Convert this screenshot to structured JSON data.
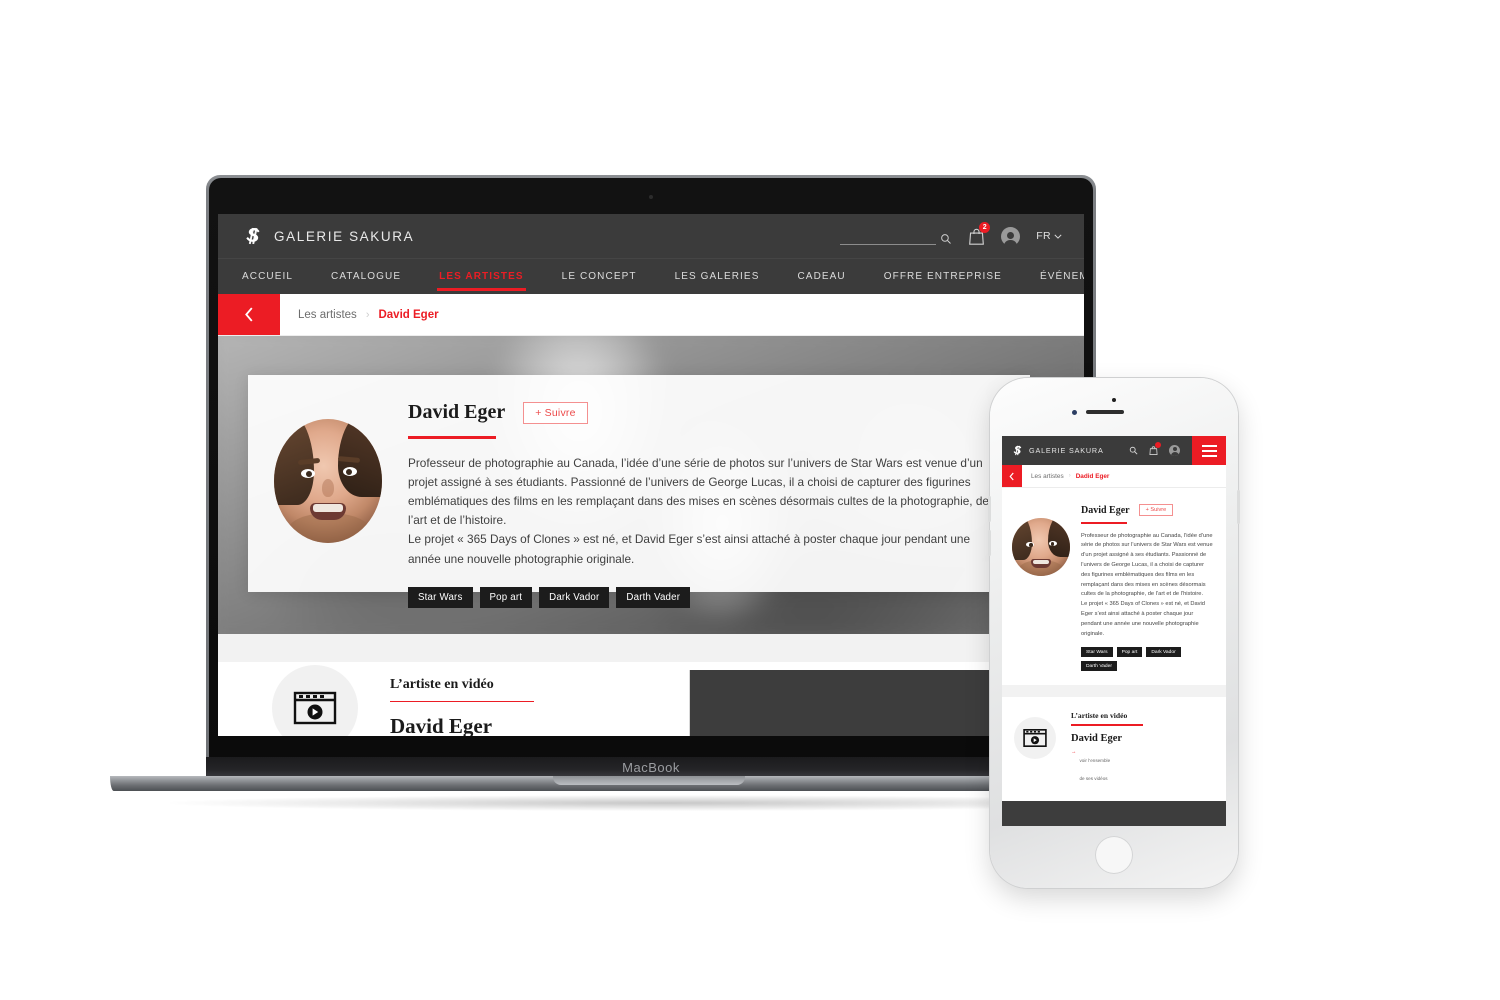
{
  "site": {
    "brand": "GALERIE SAKURA",
    "logo_icon": "sakura-s-monogram",
    "header": {
      "search_placeholder": "",
      "search_value": "",
      "search_icon": "search-icon",
      "cart_icon": "shopping-bag-icon",
      "cart_badge": "2",
      "account_icon": "user-avatar-icon",
      "language": "FR",
      "language_caret": "⌄"
    },
    "nav": [
      {
        "label": "ACCUEIL",
        "active": false
      },
      {
        "label": "CATALOGUE",
        "active": false
      },
      {
        "label": "LES ARTISTES",
        "active": true
      },
      {
        "label": "LE CONCEPT",
        "active": false
      },
      {
        "label": "LES GALERIES",
        "active": false
      },
      {
        "label": "CADEAU",
        "active": false
      },
      {
        "label": "OFFRE ENTREPRISE",
        "active": false
      },
      {
        "label": "ÉVÉNEMENTS",
        "active": false
      }
    ],
    "breadcrumb": {
      "back_icon": "chevron-left-icon",
      "parent": "Les artistes",
      "separator": "›",
      "current": "David Eger"
    },
    "artist": {
      "name": "David Eger",
      "follow_label": "+ Suivre",
      "photo_alt": "David Eger portrait",
      "bio_p1": "Professeur de photographie au Canada, l’idée d’une série de photos sur l’univers de Star Wars est venue d’un projet assigné à ses étudiants. Passionné de l’univers de George Lucas, il a choisi de capturer des figurines emblématiques des films en les remplaçant dans des mises en scènes désormais cultes de la photographie, de l’art et de l’histoire.",
      "bio_p2": "Le projet « 365 Days of Clones » est né, et David Eger s’est ainsi attaché à poster chaque jour pendant une année une nouvelle photographie originale.",
      "tags": [
        "Star Wars",
        "Pop art",
        "Dark Vador",
        "Darth Vader"
      ]
    },
    "video": {
      "icon": "film-play-icon",
      "kicker": "L’artiste en vidéo",
      "title": "David Eger",
      "link_arrow": "→",
      "link_line1": "voir l’ensemble",
      "link_line2": "de ses vidéos",
      "thumb_alt": "video thumbnail"
    }
  },
  "mobile": {
    "breadcrumb_current": "Dadid Eger",
    "menu_icon": "hamburger-menu-icon"
  },
  "devices": {
    "laptop_label": "MacBook",
    "laptop_camera": "webcam-dot",
    "phone_camera": "front-camera",
    "phone_speaker": "earpiece-speaker",
    "phone_home": "home-button"
  },
  "colors": {
    "accent": "#ec1c24",
    "header_bg": "#3b3b3b",
    "tag_bg": "#1c1c1c",
    "strip_bg": "#f2f2f2",
    "video_thumb": "#3d3d3d"
  }
}
